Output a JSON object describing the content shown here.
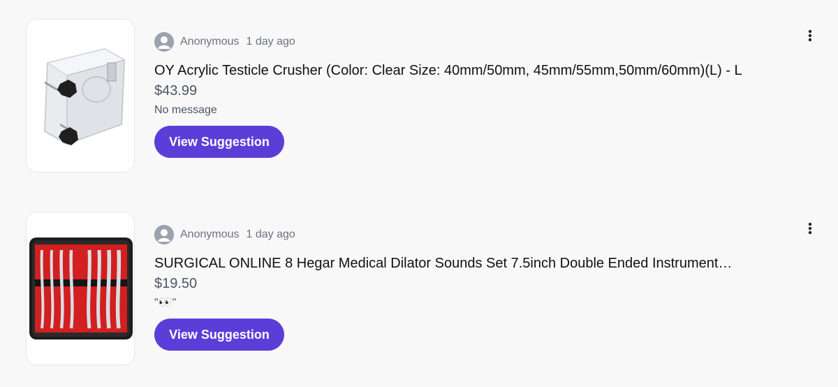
{
  "suggestions": [
    {
      "author": "Anonymous",
      "time": "1 day ago",
      "title": "OY Acrylic Testicle Crusher (Color: Clear Size: 40mm/50mm, 45mm/55mm,50mm/60mm)(L) - L",
      "price": "$43.99",
      "message": "No message",
      "button_label": "View Suggestion",
      "image": "clear-acrylic-box-product-image"
    },
    {
      "author": "Anonymous",
      "time": "1 day ago",
      "title": "SURGICAL ONLINE 8 Hegar Medical Dilator Sounds Set 7.5inch Double Ended Instrument…",
      "price": "$19.50",
      "message": "\"👀\"",
      "button_label": "View Suggestion",
      "image": "dilator-set-in-red-case-product-image"
    }
  ],
  "icons": {
    "avatar": "user-avatar-icon",
    "menu": "more-vertical-icon"
  },
  "colors": {
    "button": "#5b3ed8",
    "muted_text": "#6b7280",
    "background": "#f8f8f9"
  }
}
